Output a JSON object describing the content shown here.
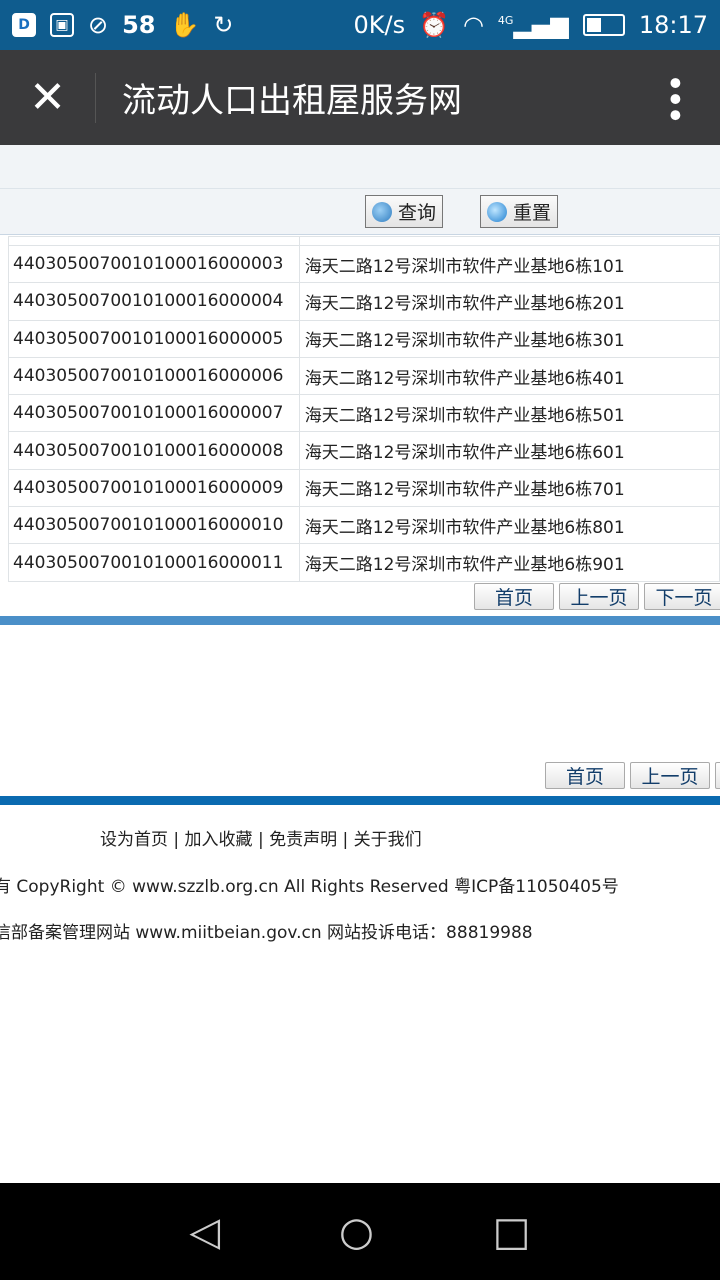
{
  "status_bar": {
    "speed": "0K/s",
    "network": "4G",
    "time": "18:17",
    "app_icons": [
      "d-app-icon",
      "image-icon",
      "camera-off-icon",
      "58-icon",
      "hand-icon",
      "sync-icon"
    ],
    "app_58": "58"
  },
  "app_bar": {
    "title": "流动人口出租屋服务网"
  },
  "filter": {
    "search_label": "查询",
    "reset_label": "重置"
  },
  "rows": [
    {
      "code": "4403050070010100016000003",
      "address": "海天二路12号深圳市软件产业基地6栋101"
    },
    {
      "code": "4403050070010100016000004",
      "address": "海天二路12号深圳市软件产业基地6栋201"
    },
    {
      "code": "4403050070010100016000005",
      "address": "海天二路12号深圳市软件产业基地6栋301"
    },
    {
      "code": "4403050070010100016000006",
      "address": "海天二路12号深圳市软件产业基地6栋401"
    },
    {
      "code": "4403050070010100016000007",
      "address": "海天二路12号深圳市软件产业基地6栋501"
    },
    {
      "code": "4403050070010100016000008",
      "address": "海天二路12号深圳市软件产业基地6栋601"
    },
    {
      "code": "4403050070010100016000009",
      "address": "海天二路12号深圳市软件产业基地6栋701"
    },
    {
      "code": "4403050070010100016000010",
      "address": "海天二路12号深圳市软件产业基地6栋801"
    },
    {
      "code": "4403050070010100016000011",
      "address": "海天二路12号深圳市软件产业基地6栋901"
    }
  ],
  "pagination": {
    "first": "首页",
    "prev": "上一页",
    "next": "下一页"
  },
  "footer": {
    "links": [
      "设为首页",
      "加入收藏",
      "免责声明",
      "关于我们"
    ],
    "sep": "|",
    "copyright": "有 CopyRight © www.szzlb.org.cn All Rights Reserved 粤ICP备11050405号",
    "record": "信部备案管理网站 www.miitbeian.gov.cn 网站投诉电话：88819988"
  },
  "colors": {
    "status_bar": "#0f5c8e",
    "app_bar": "#3a3a3c",
    "divider_light": "#4a8fc8",
    "divider_dark": "#0a6ab0"
  }
}
